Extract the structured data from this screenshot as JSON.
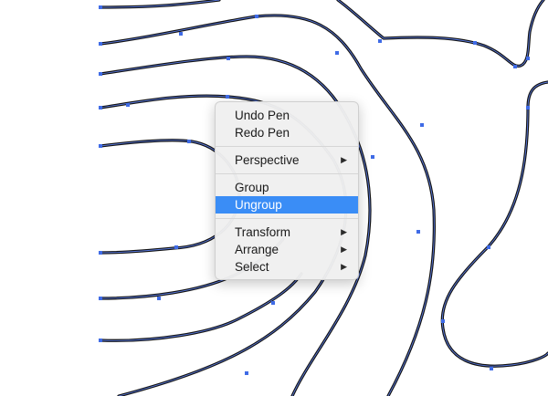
{
  "canvas": {
    "background": "#ffffff",
    "path_stroke_color": "#111111",
    "path_selection_color": "#5b7be0",
    "anchor_color": "#3f6be6"
  },
  "context_menu": {
    "groups": [
      [
        {
          "label": "Undo Pen",
          "submenu": false,
          "highlighted": false
        },
        {
          "label": "Redo Pen",
          "submenu": false,
          "highlighted": false
        }
      ],
      [
        {
          "label": "Perspective",
          "submenu": true,
          "highlighted": false
        }
      ],
      [
        {
          "label": "Group",
          "submenu": false,
          "highlighted": false
        },
        {
          "label": "Ungroup",
          "submenu": false,
          "highlighted": true
        }
      ],
      [
        {
          "label": "Transform",
          "submenu": true,
          "highlighted": false
        },
        {
          "label": "Arrange",
          "submenu": true,
          "highlighted": false
        },
        {
          "label": "Select",
          "submenu": true,
          "highlighted": false
        }
      ]
    ],
    "highlight_color": "#3a8df6",
    "submenu_arrow_icon": "triangle-right-icon"
  }
}
